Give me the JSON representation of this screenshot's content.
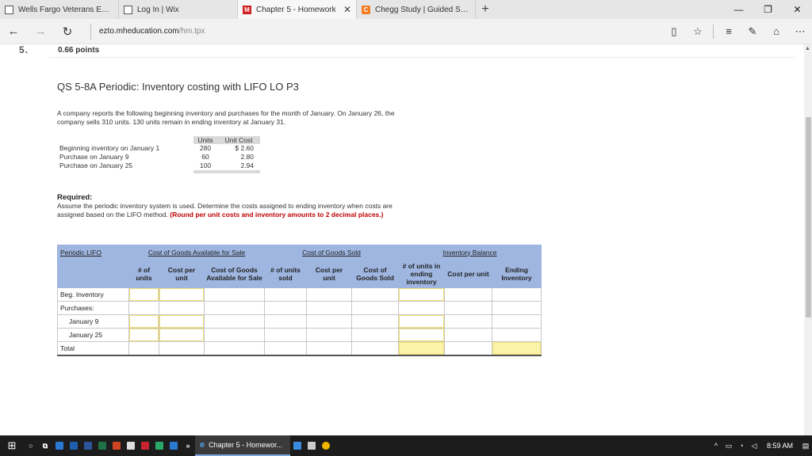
{
  "browser": {
    "tabs": [
      {
        "label": "Wells Fargo Veterans Emerg",
        "icon": "page-icon",
        "active": false
      },
      {
        "label": "Log In | Wix",
        "icon": "page-icon",
        "active": false
      },
      {
        "label": "Chapter 5 - Homework",
        "icon": "mheducation-icon",
        "active": true
      },
      {
        "label": "Chegg Study | Guided Solut",
        "icon": "chegg-icon",
        "active": false
      }
    ],
    "new_tab": "+",
    "window_controls": {
      "minimize": "—",
      "restore": "❐",
      "close": "✕"
    },
    "address": {
      "domain": "ezto.mheducation.com",
      "path": "/hm.tpx"
    }
  },
  "question": {
    "number": "5.",
    "points": "0.66 points",
    "title": "QS 5-8A Periodic: Inventory costing with LIFO LO P3",
    "intro": "A company reports the following beginning inventory and purchases for the month of January. On January 26, the company sells 310 units. 130 units remain in ending inventory at January 31.",
    "inventory_table": {
      "headers": [
        "",
        "Units",
        "Unit Cost"
      ],
      "rows": [
        {
          "label": "Beginning inventory on January 1",
          "units": "280",
          "cost": "$ 2.60"
        },
        {
          "label": "Purchase on January 9",
          "units": "60",
          "cost": "2.80"
        },
        {
          "label": "Purchase on January 25",
          "units": "100",
          "cost": "2.94"
        }
      ]
    },
    "required_heading": "Required:",
    "required_text": "Assume the periodic inventory system is used. Determine the costs assigned to ending inventory when costs are assigned based on the LIFO method.",
    "required_note": "(Round per unit costs and inventory amounts to 2 decimal places.)"
  },
  "answer_grid": {
    "group_headers": {
      "method": "Periodic LIFO",
      "available": "Cost of Goods Available for Sale",
      "sold": "Cost of Goods Sold",
      "balance": "Inventory Balance"
    },
    "column_headers": {
      "units": "# of units",
      "cost_per_unit": "Cost per unit",
      "available_for_sale": "Cost of Goods Available for Sale",
      "units_sold": "# of units sold",
      "sold_cost_per_unit": "Cost per unit",
      "cost_goods_sold": "Cost of Goods Sold",
      "units_ending": "# of units in ending inventory",
      "ending_cost_per_unit": "Cost per unit",
      "ending_inventory": "Ending Inventory"
    },
    "rows": {
      "beg": "Beg. Inventory",
      "purchases": "Purchases:",
      "jan9": "January 9",
      "jan25": "January 25",
      "total": "Total"
    }
  },
  "taskbar": {
    "active_app": "Chapter 5 - Homewor...",
    "time": "8:59 AM"
  }
}
